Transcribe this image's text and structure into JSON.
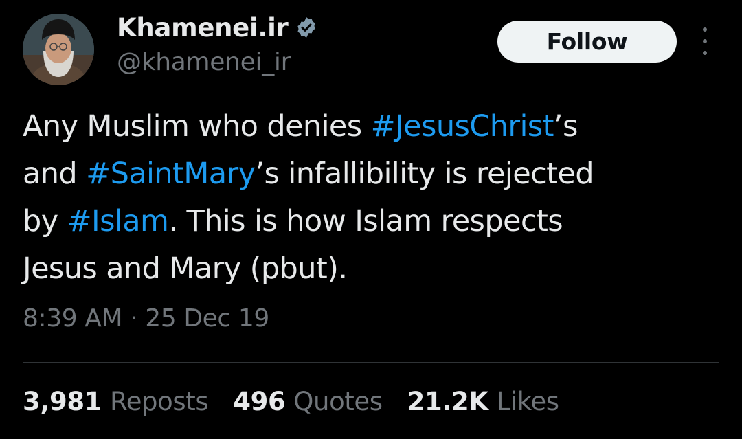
{
  "author": {
    "display_name": "Khamenei.ir",
    "handle": "@khamenei_ir",
    "verified": true
  },
  "follow_label": "Follow",
  "more_icon": "more-vertical-icon",
  "tweet": {
    "lines": [
      [
        {
          "t": "Any Muslim who denies ",
          "tag": false
        },
        {
          "t": "#JesusChrist",
          "tag": true
        },
        {
          "t": "’s",
          "tag": false
        }
      ],
      [
        {
          "t": "and ",
          "tag": false
        },
        {
          "t": "#SaintMary",
          "tag": true
        },
        {
          "t": "’s infallibility is rejected",
          "tag": false
        }
      ],
      [
        {
          "t": "by ",
          "tag": false
        },
        {
          "t": "#Islam",
          "tag": true
        },
        {
          "t": ". This is how Islam respects",
          "tag": false
        }
      ],
      [
        {
          "t": "Jesus and Mary (pbut).",
          "tag": false
        }
      ]
    ],
    "timestamp": "8:39 AM · 25 Dec 19"
  },
  "stats": {
    "reposts": {
      "count": "3,981",
      "label": "Reposts"
    },
    "quotes": {
      "count": "496",
      "label": "Quotes"
    },
    "likes": {
      "count": "21.2K",
      "label": "Likes"
    }
  },
  "colors": {
    "background": "#000000",
    "text": "#e7e9ea",
    "secondary": "#71767b",
    "hashtag": "#1d9bf0",
    "verified_badge": "#829aab",
    "button_bg": "#eff3f4",
    "divider": "#2f3336"
  }
}
